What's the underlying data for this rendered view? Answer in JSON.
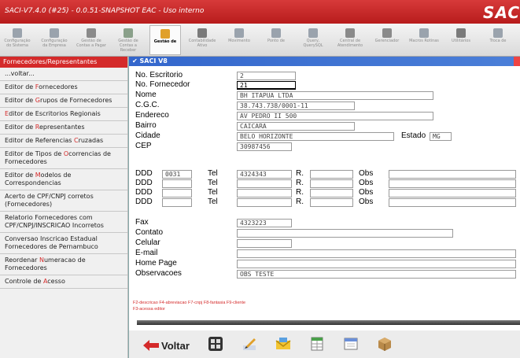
{
  "window": {
    "title": "SACI-V7.4.0 (#25) - 0.0.51-SNAPSHOT  EAC - Uso interno",
    "brand": "SAC"
  },
  "toolbar": {
    "items": [
      {
        "label": "Configuração do Sistema",
        "icon": "gear-icon"
      },
      {
        "label": "Configuração da Empresa",
        "icon": "building-icon"
      },
      {
        "label": "Gestão de Contas a Pagar",
        "icon": "wrench-icon"
      },
      {
        "label": "Gestão de Contas a Receber",
        "icon": "money-icon"
      },
      {
        "label": "Gestão de",
        "icon": "people-icon",
        "active": true
      },
      {
        "label": "Contabilidade Ativo",
        "icon": "ledger-icon"
      },
      {
        "label": "Movimento",
        "icon": "truck-icon"
      },
      {
        "label": "Ponto de",
        "icon": "tag-icon"
      },
      {
        "label": "Query, QuerySQL",
        "icon": "query-icon"
      },
      {
        "label": "Central de Atendimento",
        "icon": "person-icon"
      },
      {
        "label": "Gerenciador",
        "icon": "manager-icon"
      },
      {
        "label": "Macros Rotinas",
        "icon": "macro-icon"
      },
      {
        "label": "Utilitários",
        "icon": "tools-icon"
      },
      {
        "label": "Troca de",
        "icon": "exit-icon"
      }
    ]
  },
  "menu": {
    "header": "Fornecedores/Representantes",
    "items": [
      {
        "pre": "...voltar...",
        "hl": "",
        "post": ""
      },
      {
        "pre": "Editor de ",
        "hl": "F",
        "post": "ornecedores"
      },
      {
        "pre": "Editor de ",
        "hl": "G",
        "post": "rupos de Fornecedores"
      },
      {
        "pre": "",
        "hl": "E",
        "post": "ditor de Escritorios Regionais"
      },
      {
        "pre": "Editor de ",
        "hl": "R",
        "post": "epresentantes"
      },
      {
        "pre": "Editor de Referencias ",
        "hl": "C",
        "post": "ruzadas"
      },
      {
        "pre": "Editor de Tipos de ",
        "hl": "O",
        "post": "correncias de Fornecedores"
      },
      {
        "pre": "Editor de ",
        "hl": "M",
        "post": "odelos de Correspondencias"
      },
      {
        "pre": "Acerto de CPF/CNPJ corretos (Fornecedores)",
        "hl": "",
        "post": ""
      },
      {
        "pre": "Relatorio Fornecedores com CPF/CNPJ/INSCRICAO Incorretos",
        "hl": "",
        "post": ""
      },
      {
        "pre": "Conversao Inscricao Estadual Fornecedores de Pernambuco",
        "hl": "",
        "post": ""
      },
      {
        "pre": "Reordenar ",
        "hl": "N",
        "post": "umeracao de Fornecedores"
      },
      {
        "pre": "Controle de ",
        "hl": "A",
        "post": "cesso"
      }
    ]
  },
  "dialog": {
    "title": "SACI V8",
    "labels": {
      "escritorio": "No. Escritorio",
      "fornecedor": "No. Fornecedor",
      "nome": "Nome",
      "cgc": "C.G.C.",
      "endereco": "Endereco",
      "bairro": "Bairro",
      "cidade": "Cidade",
      "estado": "Estado",
      "cep": "CEP",
      "ddd": "DDD",
      "tel": "Tel",
      "r": "R.",
      "obs": "Obs",
      "fax": "Fax",
      "contato": "Contato",
      "celular": "Celular",
      "email": "E-mail",
      "homepage": "Home Page",
      "observacoes": "Observacoes"
    },
    "values": {
      "escritorio": "2",
      "fornecedor": "21",
      "nome": "BH ITAPUA LTDA",
      "cgc": "38.743.738/0001-11",
      "endereco": "AV PEDRO II 500",
      "bairro": "CAICARA",
      "cidade": "BELO HORIZONTE",
      "estado": "MG",
      "cep": "30987456",
      "ddd1": "0031",
      "tel1": "4324343",
      "fax": "4323223",
      "observacoes": "OBS TESTE"
    },
    "hints": {
      "line1": "F2-descricao  F4-abreviacao  F7-cnpj  F8-fantasia  F9-cliente",
      "line2": "F3-acessa editor"
    },
    "buttons": {
      "voltar": "Voltar"
    }
  },
  "colors": {
    "accent": "#d42a2a",
    "dialog_title": "#3366cc"
  }
}
